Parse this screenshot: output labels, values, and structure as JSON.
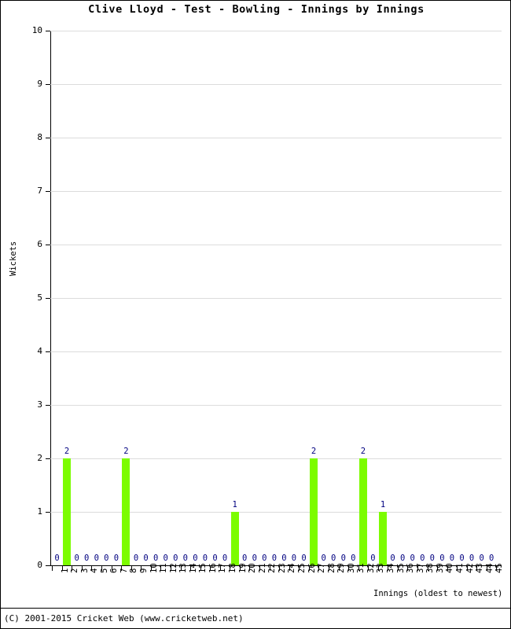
{
  "chart_data": {
    "type": "bar",
    "title": "Clive Lloyd - Test - Bowling - Innings by Innings",
    "xlabel": "Innings (oldest to newest)",
    "ylabel": "Wickets",
    "ylim": [
      0,
      10
    ],
    "ytick_labels": [
      "0",
      "1",
      "2",
      "3",
      "4",
      "5",
      "6",
      "7",
      "8",
      "9",
      "10"
    ],
    "ytick_values": [
      0,
      1,
      2,
      3,
      4,
      5,
      6,
      7,
      8,
      9,
      10
    ],
    "grid": true,
    "legend": "none",
    "bar_color": "#7CFC00",
    "value_label_color": "#000080",
    "categories": [
      "1",
      "2",
      "3",
      "4",
      "5",
      "6",
      "7",
      "8",
      "9",
      "10",
      "11",
      "12",
      "13",
      "14",
      "15",
      "16",
      "17",
      "18",
      "19",
      "20",
      "21",
      "22",
      "23",
      "24",
      "25",
      "26",
      "27",
      "28",
      "29",
      "30",
      "31",
      "32",
      "33",
      "34",
      "35",
      "36",
      "37",
      "38",
      "39",
      "40",
      "41",
      "42",
      "43",
      "44",
      "45"
    ],
    "values": [
      0,
      2,
      0,
      0,
      0,
      0,
      0,
      2,
      0,
      0,
      0,
      0,
      0,
      0,
      0,
      0,
      0,
      0,
      1,
      0,
      0,
      0,
      0,
      0,
      0,
      0,
      2,
      0,
      0,
      0,
      0,
      2,
      0,
      1,
      0,
      0,
      0,
      0,
      0,
      0,
      0,
      0,
      0,
      0,
      0
    ],
    "value_labels": [
      "0",
      "2",
      "0",
      "0",
      "0",
      "0",
      "0",
      "2",
      "0",
      "0",
      "0",
      "0",
      "0",
      "0",
      "0",
      "0",
      "0",
      "0",
      "1",
      "0",
      "0",
      "0",
      "0",
      "0",
      "0",
      "0",
      "2",
      "0",
      "0",
      "0",
      "0",
      "2",
      "0",
      "1",
      "0",
      "0",
      "0",
      "0",
      "0",
      "0",
      "0",
      "0",
      "0",
      "0",
      "0"
    ]
  },
  "footer": {
    "copyright": "(C) 2001-2015 Cricket Web (www.cricketweb.net)"
  }
}
